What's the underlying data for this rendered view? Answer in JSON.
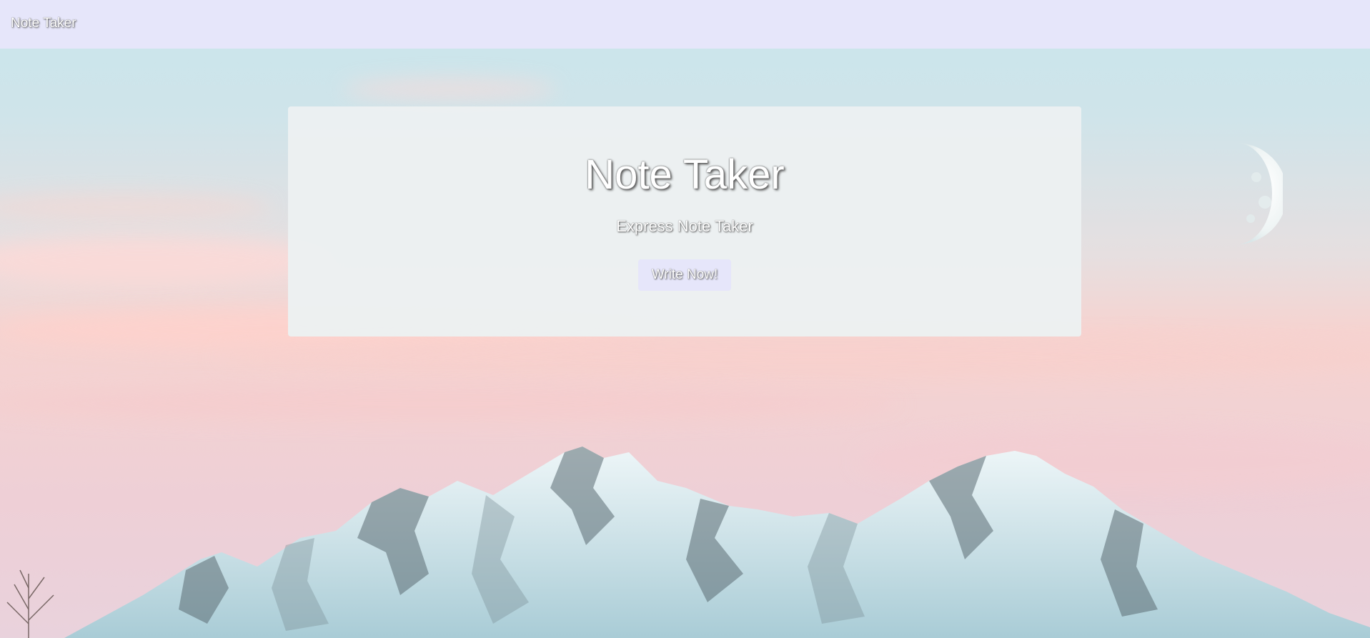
{
  "navbar": {
    "brand": "Note Taker"
  },
  "jumbotron": {
    "title": "Note Taker",
    "subtitle": "Express Note Taker",
    "cta_label": "Write Now!"
  },
  "background": {
    "scene": "mountain-landscape-image",
    "moon": "moon-icon"
  },
  "colors": {
    "navbar_bg": "#e6e6fa",
    "card_bg": "#ecf0f1",
    "button_bg": "#e6e6fa",
    "text": "#ffffff"
  }
}
